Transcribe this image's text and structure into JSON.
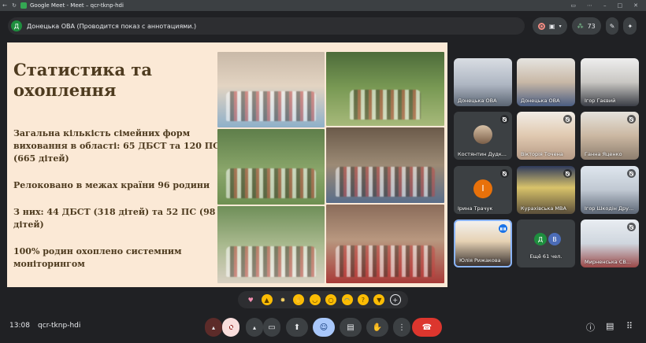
{
  "window": {
    "title": "Google Meet - Meet – qcr-tknp-hdi"
  },
  "topbar": {
    "avatar_letter": "Д",
    "presenter_text": "Донецька ОВА (Проводится показ с аннотациями.)",
    "participant_count": "73"
  },
  "slide": {
    "title": "Статистика та охоплення",
    "paragraphs": [
      "Загальна кількість сімейних форм виховання в області: 65 ДБСТ та 120 ПС (665 дітей)",
      "Релоковано в межах країни 96 родини",
      "З них: 44 ДБСТ (318 дітей) та 52 ПС (98 дітей)",
      "100% родин охоплено системним моніторингом"
    ]
  },
  "tiles": [
    {
      "name": "Донецька ОВА",
      "muted": false
    },
    {
      "name": "Донецька ОВА",
      "muted": false
    },
    {
      "name": "Ігор Гаєвий",
      "muted": false
    },
    {
      "name": "Костянтин Дудк...",
      "muted": true
    },
    {
      "name": "Вікторія Точена",
      "muted": true
    },
    {
      "name": "Ганна Яценко",
      "muted": true
    },
    {
      "name": "Ірина Трачук",
      "muted": true,
      "letter": "І"
    },
    {
      "name": "Курахівська МВА",
      "muted": true
    },
    {
      "name": "Ігор Шкодін Дру...",
      "muted": true
    },
    {
      "name": "Юлія Рижакова",
      "muted": false
    },
    {
      "name": "Ещё 61 чел.",
      "letters": [
        "Д",
        "В"
      ]
    },
    {
      "name": "Мирненська СВ...",
      "muted": true
    }
  ],
  "colors": {
    "slide_bg": "#fbe9d6",
    "slide_text": "#4e3b1f",
    "hangup": "#dc362e",
    "active_speaker": "#8ab4f8"
  },
  "icons": {
    "reactions": [
      "heart-icon",
      "thumbs-up-icon",
      "party-icon",
      "clap-icon",
      "laugh-icon",
      "surprised-icon",
      "crying-icon",
      "thinking-icon",
      "thumbs-down-icon",
      "add-reaction-icon"
    ]
  },
  "bottom": {
    "time": "13:08",
    "meeting_code": "qcr-tknp-hdi"
  }
}
